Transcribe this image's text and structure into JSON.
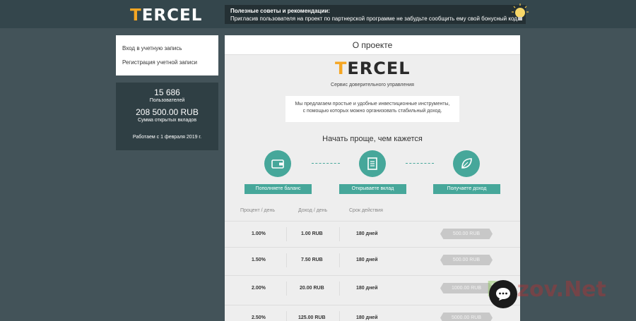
{
  "header": {
    "logo_first": "T",
    "logo_rest": "ERCEL",
    "tip_title": "Полезные советы и рекомендации:",
    "tip_text": "Пригласив пользователя на проект по партнерской программе не забудьте сообщить ему свой бонусный код.",
    "bulb_icon": "lightbulb-icon"
  },
  "sidebar": {
    "menu": [
      {
        "label": "Вход в учетную запись"
      },
      {
        "label": "Регистрация учетной записи"
      }
    ],
    "stats": {
      "users_count": "15 686",
      "users_label": "Пользователей",
      "deposits_sum": "208 500.00 RUB",
      "deposits_label": "Сумма открытых вкладов",
      "since": "Работаем с 1 февраля 2019 г."
    }
  },
  "main": {
    "title": "О проекте",
    "logo_first": "T",
    "logo_rest": "ERCEL",
    "subtitle": "Сервис доверительного управления",
    "description_line1": "Мы предлагаем простые и удобные инвестиционные инструменты,",
    "description_line2": "с помощью которых можно организовать стабильный доход.",
    "start_heading": "Начать проще, чем кажется",
    "steps": [
      {
        "label": "Пополняете баланс",
        "icon": "wallet-icon"
      },
      {
        "label": "Открываете вклад",
        "icon": "document-icon"
      },
      {
        "label": "Получаете доход",
        "icon": "leaf-icon"
      }
    ],
    "table": {
      "headers": [
        "Процент / день",
        "Доход / день",
        "Срок действия"
      ],
      "rows": [
        {
          "percent": "1.00%",
          "income": "1.00 RUB",
          "term": "180 дней",
          "amount": "500.00 RUB"
        },
        {
          "percent": "1.50%",
          "income": "7.50 RUB",
          "term": "180 дней",
          "amount": "500.00 RUB"
        },
        {
          "percent": "2.00%",
          "income": "20.00 RUB",
          "term": "180 дней",
          "amount": "1000.00 RUB"
        },
        {
          "percent": "2.50%",
          "income": "125.00 RUB",
          "term": "180 дней",
          "amount": "5000.00 RUB"
        }
      ]
    }
  },
  "overlay": {
    "watermark_first": "B",
    "watermark_rest": "ozov.Net",
    "chat_icon": "chat-icon"
  },
  "colors": {
    "background": "#435359",
    "accent": "#46a79a",
    "logo_accent": "#f5a623"
  }
}
